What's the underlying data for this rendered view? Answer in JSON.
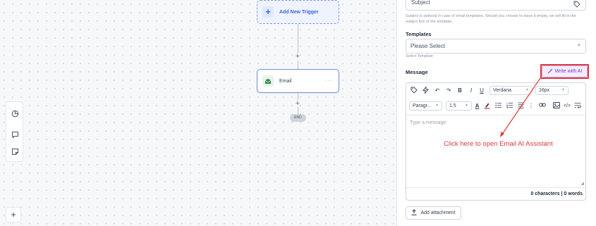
{
  "canvas": {
    "trigger": {
      "label": "Add New Trigger"
    },
    "node": {
      "label": "Email",
      "menu": "···"
    },
    "end_label": "END",
    "plus_small": "+",
    "side_tools": [
      {
        "icon": "pie-chart-icon"
      },
      {
        "icon": "comment-icon"
      },
      {
        "icon": "note-icon"
      }
    ],
    "zoom_in": "+"
  },
  "panel": {
    "subject": {
      "value": "Subject",
      "help": "Subject is optional in case of email templates. Should you choose to leave it empty, we will fill in the subject line of the template."
    },
    "templates": {
      "label": "Templates",
      "selected": "Please Select",
      "help": "Select Template"
    },
    "message": {
      "label": "Message",
      "ai_button": "Write with AI",
      "toolbar": {
        "font": "Verdana",
        "size": "16px",
        "paragraph": "Paragr...",
        "line_height": "1.5",
        "bold": "B",
        "italic": "I",
        "underline": "U",
        "text_color": "A"
      },
      "placeholder": "Type a message",
      "counts": "0 characters | 0 words"
    },
    "attach_label": "Add attachment"
  },
  "annotation": {
    "text": "Click here to open Email AI Assistant",
    "color": "#e0393e"
  },
  "colors": {
    "accent": "#3b63d8",
    "ai": "#6d3fd2",
    "highlight": "#e0393e"
  }
}
